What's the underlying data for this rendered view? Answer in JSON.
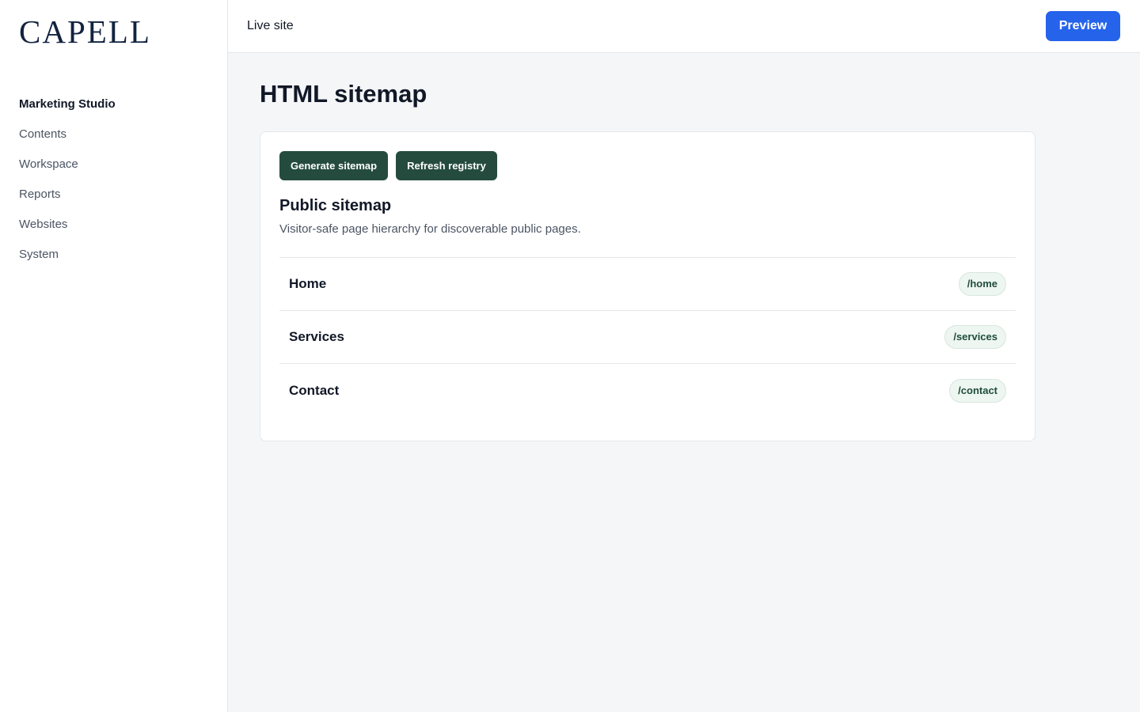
{
  "brand": {
    "logo_text": "CAPELL"
  },
  "sidebar": {
    "heading": "Marketing Studio",
    "items": [
      {
        "label": "Contents"
      },
      {
        "label": "Workspace"
      },
      {
        "label": "Reports"
      },
      {
        "label": "Websites"
      },
      {
        "label": "System"
      }
    ]
  },
  "header": {
    "live_site_label": "Live site",
    "preview_label": "Preview"
  },
  "main": {
    "page_title": "HTML sitemap",
    "actions": {
      "generate_label": "Generate sitemap",
      "refresh_label": "Refresh registry"
    },
    "section": {
      "title": "Public sitemap",
      "description": "Visitor-safe page hierarchy for discoverable public pages."
    },
    "pages": [
      {
        "name": "Home",
        "path": "/home"
      },
      {
        "name": "Services",
        "path": "/services"
      },
      {
        "name": "Contact",
        "path": "/contact"
      }
    ]
  },
  "colors": {
    "primary": "#2563eb",
    "action": "#254b3f",
    "badge_bg": "#eef6f1",
    "badge_text": "#1f4d3a",
    "logo": "#12233f"
  }
}
